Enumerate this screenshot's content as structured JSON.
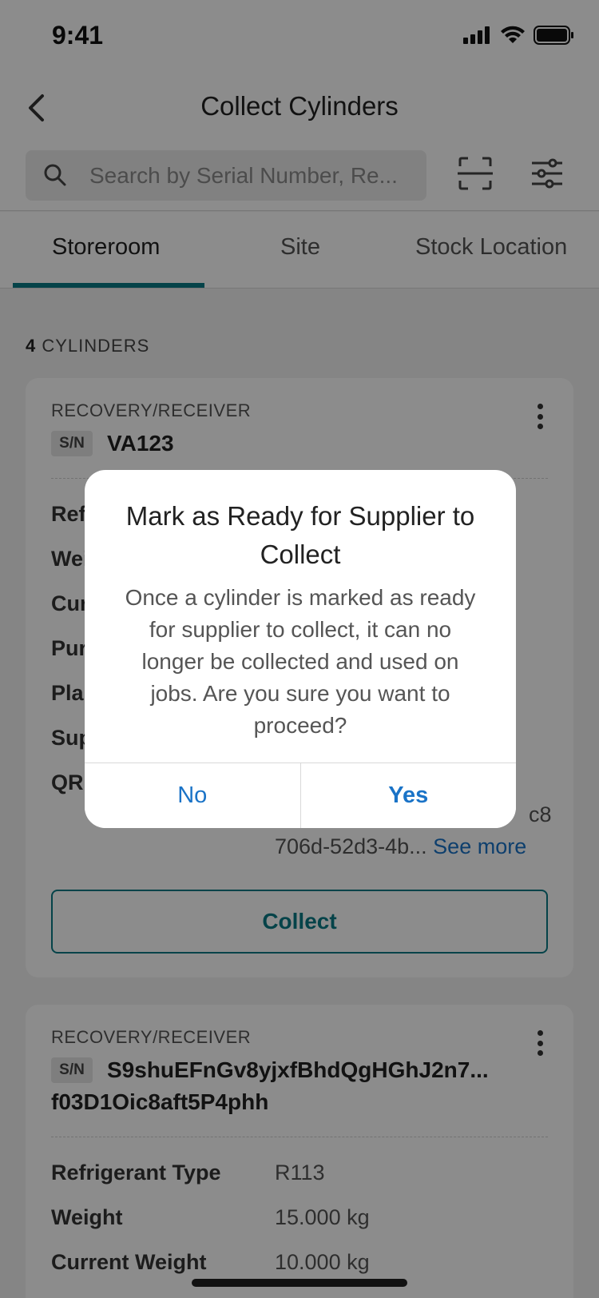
{
  "status_bar": {
    "time": "9:41"
  },
  "header": {
    "title": "Collect Cylinders"
  },
  "search": {
    "placeholder": "Search by Serial Number, Re..."
  },
  "tabs": [
    {
      "label": "Storeroom",
      "active": true
    },
    {
      "label": "Site",
      "active": false
    },
    {
      "label": "Stock Location",
      "active": false
    }
  ],
  "list": {
    "count": "4",
    "count_label": "CYLINDERS"
  },
  "cards": [
    {
      "type": "RECOVERY/RECEIVER",
      "sn_badge": "S/N",
      "serial": "VA123",
      "rows": [
        {
          "label": "Ref",
          "value": ""
        },
        {
          "label": "Wei",
          "value": ""
        },
        {
          "label": "Cur",
          "value": ""
        },
        {
          "label": "Pur",
          "value": ""
        },
        {
          "label": "Plan",
          "value": ""
        },
        {
          "label": "Sup",
          "value": ""
        },
        {
          "label": "QR",
          "value": ""
        }
      ],
      "qr_value_line1": "c8",
      "qr_value_line2": "706d-52d3-4b...",
      "see_more": "See more",
      "collect_label": "Collect"
    },
    {
      "type": "RECOVERY/RECEIVER",
      "sn_badge": "S/N",
      "serial_line1": "S9shuEFnGv8yjxfBhdQgHGhJ2n7...",
      "serial_line2": "f03D1Oic8aft5P4phh",
      "rows": [
        {
          "label": "Refrigerant Type",
          "value": "R113"
        },
        {
          "label": "Weight",
          "value": "15.000 kg"
        },
        {
          "label": "Current Weight",
          "value": "10.000 kg"
        }
      ]
    }
  ],
  "dialog": {
    "title": "Mark as Ready for Supplier to Collect",
    "message": "Once a cylinder is marked as ready for supplier to collect, it can no longer be collected and used on jobs. Are you sure you want to proceed?",
    "no_label": "No",
    "yes_label": "Yes"
  },
  "colors": {
    "accent": "#0a7b86",
    "link": "#1a73c7"
  }
}
